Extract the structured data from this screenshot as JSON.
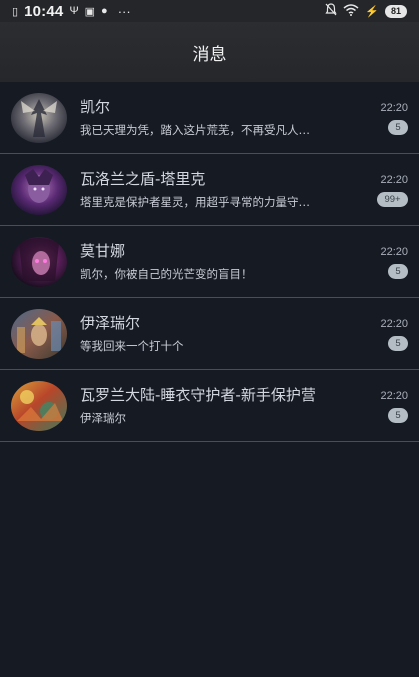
{
  "status_bar": {
    "time": "10:44",
    "left_icons": [
      "sim-icon",
      "usb-icon",
      "notification-icon",
      "app-icon"
    ],
    "more": "···",
    "battery": "81",
    "right_icons": [
      "mute-icon",
      "wifi-icon",
      "charging-icon"
    ]
  },
  "header": {
    "title": "消息"
  },
  "conversations": [
    {
      "name": "凯尔",
      "preview": "我已天理为凭，踏入这片荒芜，不再受凡人…",
      "time": "22:20",
      "badge": "5"
    },
    {
      "name": "瓦洛兰之盾-塔里克",
      "preview": "塔里克是保护者星灵，用超乎寻常的力量守…",
      "time": "22:20",
      "badge": "99+"
    },
    {
      "name": "莫甘娜",
      "preview": "凯尔，你被自己的光芒变的盲目！",
      "time": "22:20",
      "badge": "5"
    },
    {
      "name": "伊泽瑞尔",
      "preview": "等我回来一个打十个",
      "time": "22:20",
      "badge": "5"
    },
    {
      "name": "瓦罗兰大陆-睡衣守护者-新手保护营",
      "preview": "伊泽瑞尔",
      "time": "22:20",
      "badge": "5"
    }
  ],
  "colors": {
    "background": "#161a23",
    "header": "#2a2c30",
    "divider": "#4a4e57",
    "badge": "#b4bcc4"
  }
}
